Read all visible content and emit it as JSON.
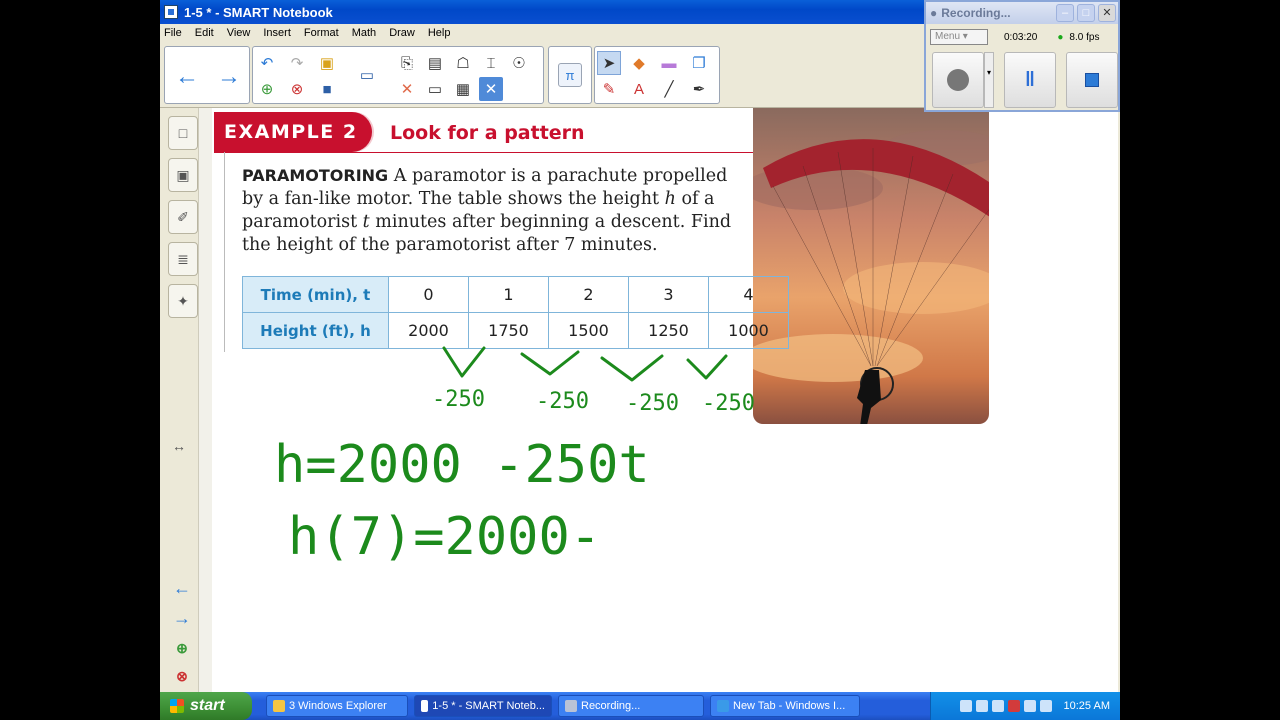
{
  "window": {
    "title": "1-5 * - SMART Notebook"
  },
  "menu": [
    "File",
    "Edit",
    "View",
    "Insert",
    "Format",
    "Math",
    "Draw",
    "Help"
  ],
  "toolbar": {
    "back_icon": "arrow-left-icon",
    "forward_icon": "arrow-right-icon",
    "math_label": "π"
  },
  "recorder": {
    "title": "Recording...",
    "menu_label": "Menu",
    "elapsed": "0:03:20",
    "fps": "8.0 fps"
  },
  "lesson": {
    "example_label": "EXAMPLE 2",
    "example_title": "Look for a pattern",
    "problem_keyword": "PARAMOTORING",
    "problem_text_1": "A paramotor is a parachute propelled by a fan-like motor. The table shows the height ",
    "var_h": "h",
    "problem_text_2": " of a paramotorist ",
    "var_t": "t",
    "problem_text_3": " minutes after beginning a descent. Find the height of the paramotorist after 7 minutes.",
    "table": {
      "row1_header": "Time (min), t",
      "row2_header": "Height (ft), h",
      "times": [
        "0",
        "1",
        "2",
        "3",
        "4"
      ],
      "heights": [
        "2000",
        "1750",
        "1500",
        "1250",
        "1000"
      ]
    }
  },
  "handwriting": {
    "differences": [
      "-250",
      "-250",
      "-250",
      "-250"
    ],
    "equation_1": "h=2000 -250t",
    "equation_2": "h(7)=2000-"
  },
  "taskbar": {
    "start": "start",
    "tasks": [
      "3 Windows Explorer",
      "1-5 * - SMART Noteb...",
      "Recording...",
      "New Tab - Windows I..."
    ],
    "clock": "10:25 AM"
  }
}
